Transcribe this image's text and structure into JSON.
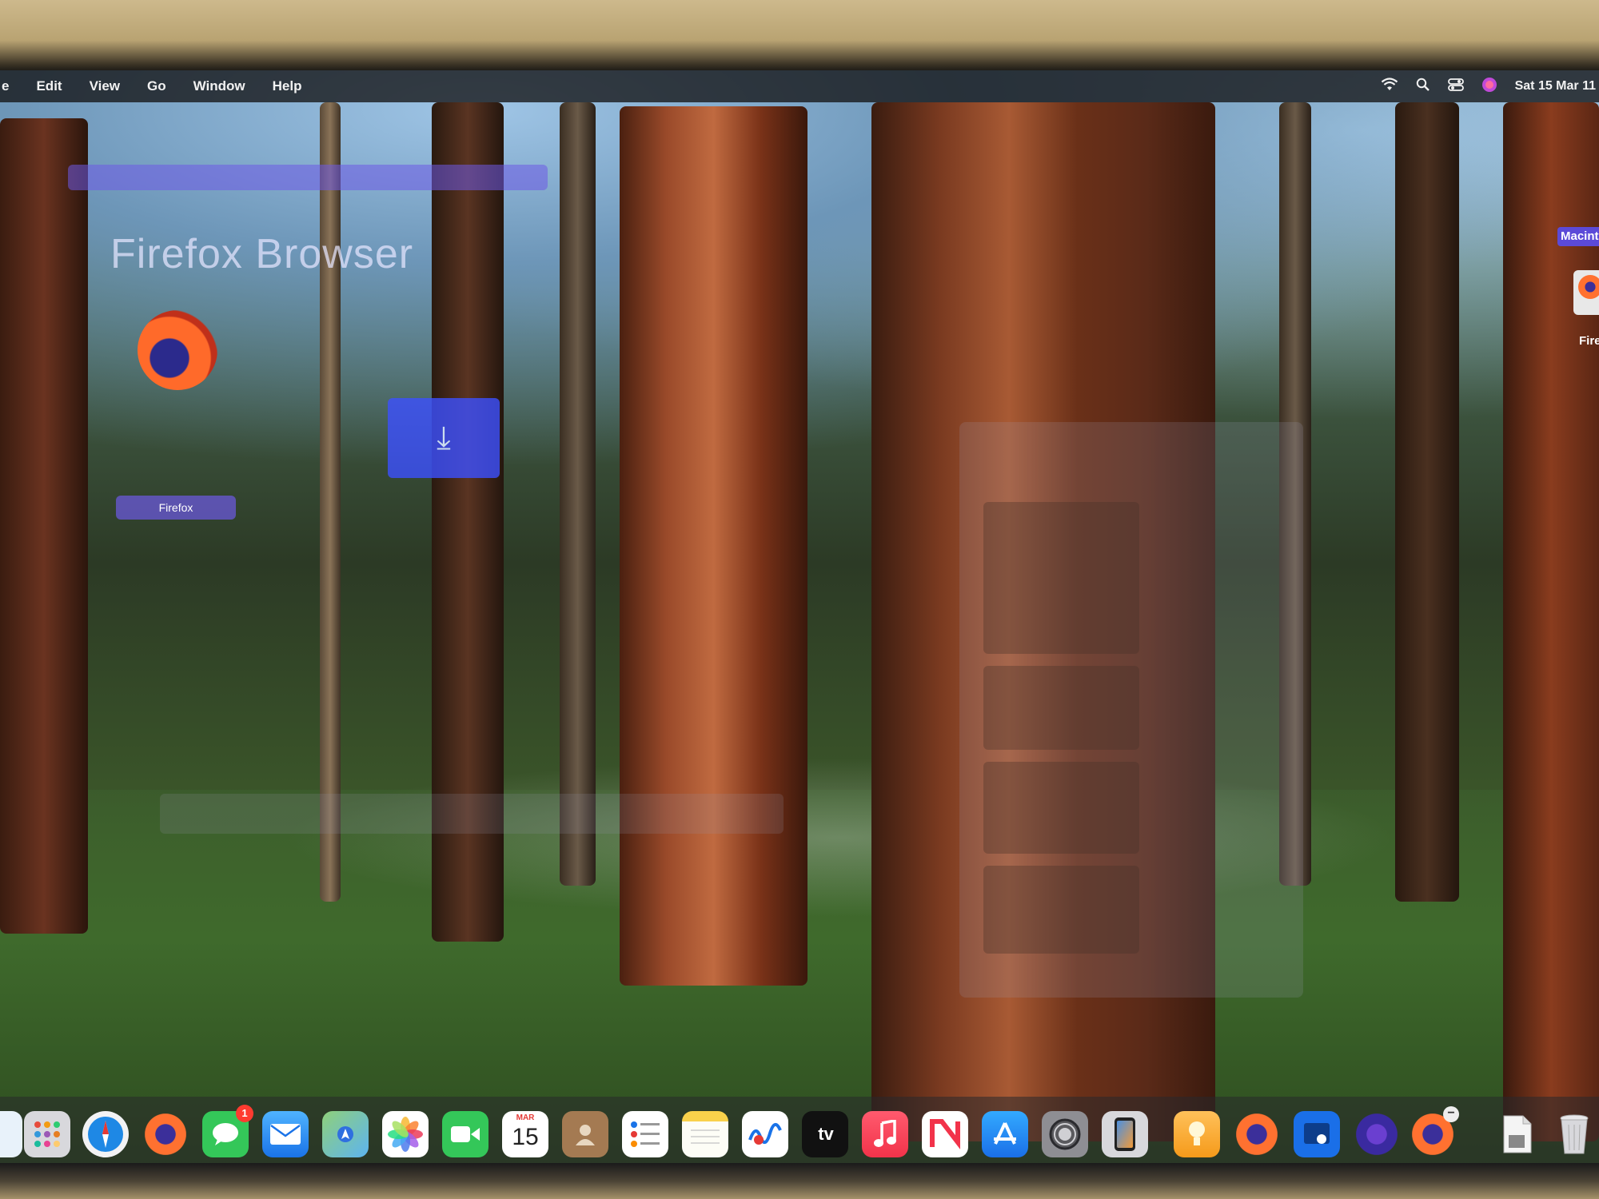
{
  "menubar": {
    "items": [
      "e",
      "Edit",
      "View",
      "Go",
      "Window",
      "Help"
    ],
    "clock": "Sat 15 Mar 11",
    "icons": [
      "wifi-icon",
      "search-icon",
      "control-center-icon",
      "siri-icon"
    ]
  },
  "ghost": {
    "title": "Firefox Browser",
    "label": "Firefox"
  },
  "desktop": {
    "disk_label": "Macintosh",
    "firefox_label": "Fire"
  },
  "dock": {
    "calendar_month": "MAR",
    "calendar_day": "15",
    "messages_badge": "1",
    "tv_label": "tv",
    "icons": [
      "finder-icon",
      "launchpad-icon",
      "safari-icon",
      "firefox-icon",
      "messages-icon",
      "mail-icon",
      "maps-icon",
      "photos-icon",
      "facetime-icon",
      "calendar-icon",
      "contacts-icon",
      "reminders-icon",
      "notes-icon",
      "freeform-icon",
      "apple-tv-icon",
      "music-icon",
      "news-icon",
      "app-store-icon",
      "system-settings-icon",
      "iphone-mirroring-icon",
      "keynote-icon",
      "firefox-icon-2",
      "preview-icon",
      "firefox-nightly-icon",
      "firefox-icon-3",
      "document-icon",
      "trash-icon"
    ]
  }
}
